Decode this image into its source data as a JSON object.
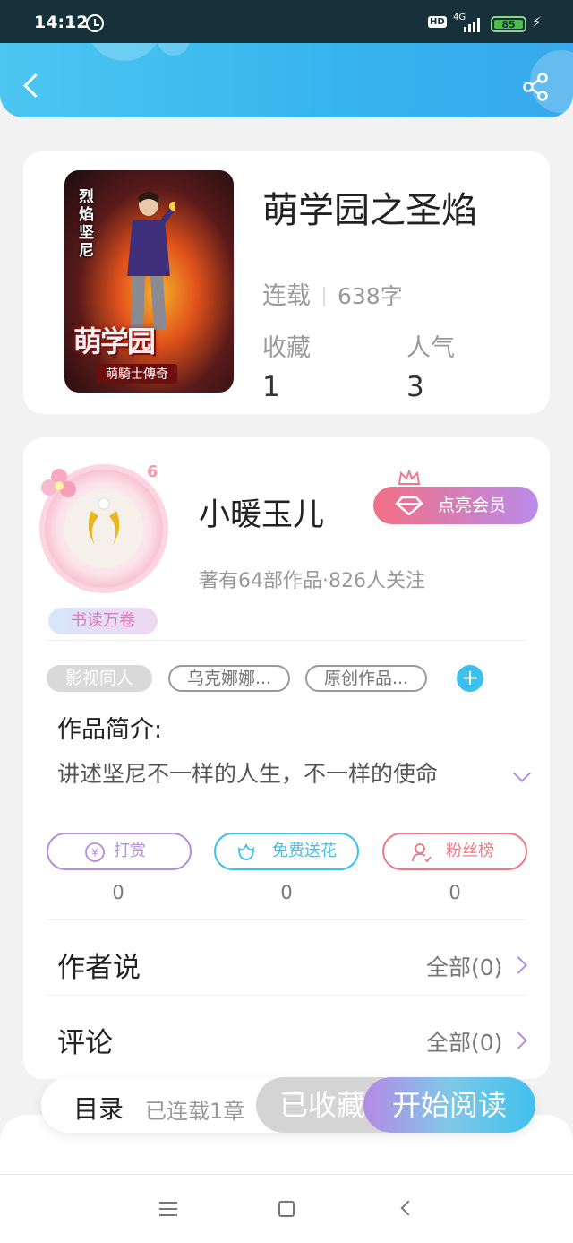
{
  "status_bar": {
    "time": "14:12",
    "hd": "HD",
    "network": "4G",
    "battery": "85"
  },
  "book": {
    "title": "萌学园之圣焰",
    "status": "连载",
    "word_count": "638字",
    "favorites_label": "收藏",
    "favorites_value": "1",
    "popularity_label": "人气",
    "popularity_value": "3",
    "cover": {
      "vertical_text": "烈焰坚尼",
      "title_art": "萌学园",
      "subtitle": "萌騎士傳奇"
    }
  },
  "author": {
    "name": "小暖玉儿",
    "level": "6",
    "badge": "书读万卷",
    "vip_label": "点亮会员",
    "meta": "著有64部作品·826人关注"
  },
  "tags": [
    {
      "label": "影视同人",
      "style": "filled"
    },
    {
      "label": "乌克娜娜...",
      "style": "outline"
    },
    {
      "label": "原创作品...",
      "style": "outline"
    }
  ],
  "intro": {
    "heading": "作品简介:",
    "text": "讲述坚尼不一样的人生，不一样的使命"
  },
  "actions": [
    {
      "label": "打赏",
      "icon": "yuan-coin-icon",
      "count": "0",
      "color": "#b68de0"
    },
    {
      "label": "免费送花",
      "icon": "flower-icon",
      "count": "0",
      "color": "#3cc1ec"
    },
    {
      "label": "粉丝榜",
      "icon": "fan-user-icon",
      "count": "0",
      "color": "#ec7a84"
    }
  ],
  "sections": {
    "author_says": {
      "title": "作者说",
      "link": "全部(0)"
    },
    "comments": {
      "title": "评论",
      "link": "全部(0)"
    }
  },
  "bottom_bar": {
    "toc": "目录",
    "chapters": "已连载1章",
    "collected": "已收藏",
    "start_reading": "开始阅读"
  }
}
